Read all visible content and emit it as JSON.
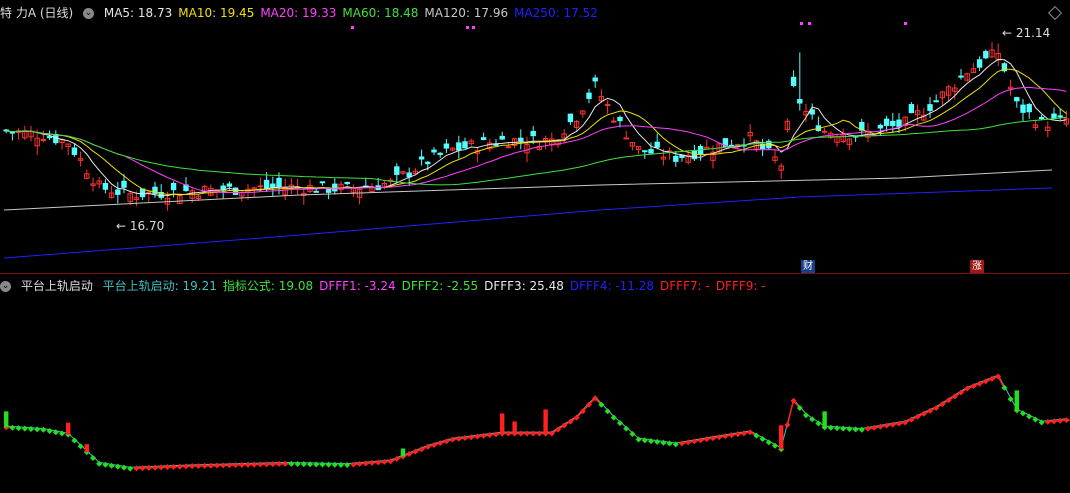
{
  "top": {
    "symbol": "特 力A (日线)",
    "indicators": [
      {
        "label": "MA5: 18.73",
        "color": "#e8e8e8"
      },
      {
        "label": "MA10: 19.45",
        "color": "#f0e000"
      },
      {
        "label": "MA20: 19.33",
        "color": "#ff40ff"
      },
      {
        "label": "MA60: 18.48",
        "color": "#40e040"
      },
      {
        "label": "MA120: 17.96",
        "color": "#c8c8c8"
      },
      {
        "label": "MA250: 17.52",
        "color": "#2020ff"
      }
    ],
    "high_label": "21.14",
    "low_label": "16.70",
    "badge_cai": "财",
    "badge_zhang": "涨"
  },
  "bottom": {
    "title": "平台上轨启动",
    "indicators": [
      {
        "label": "平台上轨启动: 19.21",
        "color": "#40c0c0"
      },
      {
        "label": "指标公式: 19.08",
        "color": "#40e040"
      },
      {
        "label": "DFFF1: -3.24",
        "color": "#ff40ff"
      },
      {
        "label": "DFFF2: -2.55",
        "color": "#40e040"
      },
      {
        "label": "DFFF3: 25.48",
        "color": "#e8e8e8"
      },
      {
        "label": "DFFF4: -11.28",
        "color": "#2020ff"
      },
      {
        "label": "DFFF7: -",
        "color": "#ff2020"
      },
      {
        "label": "DFFF9: -",
        "color": "#ff2020"
      }
    ]
  },
  "colors": {
    "up": "#ff3030",
    "down": "#54ffff",
    "bg": "#000000",
    "bot_up": "#ff2020",
    "bot_down": "#20e020"
  }
}
